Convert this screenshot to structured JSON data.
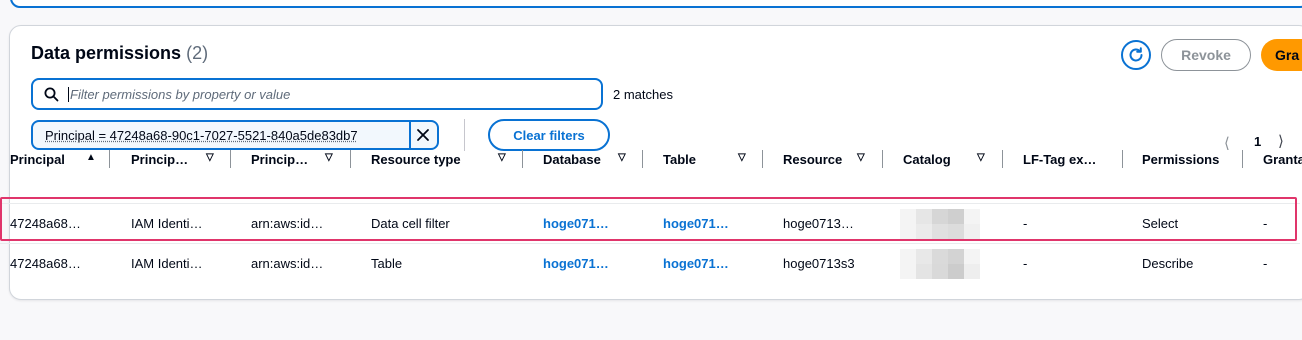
{
  "panel": {
    "title": "Data permissions",
    "count": "(2)",
    "revoke_label": "Revoke",
    "grant_label": "Gra"
  },
  "search": {
    "placeholder": "Filter permissions by property or value",
    "matches_text": "2 matches"
  },
  "filter_token": {
    "label": "Principal = 47248a68-90c1-7027-5521-840a5de83db7"
  },
  "clear_filters_label": "Clear filters",
  "pagination": {
    "current_page": "1"
  },
  "table": {
    "columns": [
      {
        "label": "Principal",
        "sort": "▲"
      },
      {
        "label": "Princip…",
        "sort": "▽"
      },
      {
        "label": "Princip…",
        "sort": "▽"
      },
      {
        "label": "Resource type",
        "sort": "▽"
      },
      {
        "label": "Database",
        "sort": "▽"
      },
      {
        "label": "Table",
        "sort": "▽"
      },
      {
        "label": "Resource",
        "sort": "▽"
      },
      {
        "label": "Catalog",
        "sort": "▽"
      },
      {
        "label": "LF-Tag ex…",
        "sort": ""
      },
      {
        "label": "Permissions",
        "sort": ""
      },
      {
        "label": "Granta",
        "sort": ""
      }
    ],
    "rows": [
      {
        "principal": "47248a68…",
        "principal_type": "IAM Identi…",
        "principal_arn": "arn:aws:id…",
        "resource_type": "Data cell filter",
        "database": "hoge071…",
        "table": "hoge071…",
        "resource": "hoge0713…",
        "lf_tag": "-",
        "permissions": "Select",
        "grantable": "-"
      },
      {
        "principal": "47248a68…",
        "principal_type": "IAM Identi…",
        "principal_arn": "arn:aws:id…",
        "resource_type": "Table",
        "database": "hoge071…",
        "table": "hoge071…",
        "resource": "hoge0713s3",
        "lf_tag": "-",
        "permissions": "Describe",
        "grantable": "-"
      }
    ]
  },
  "colors": {
    "accent": "#0972d3",
    "grant_button": "#ff9900",
    "highlight": "#e0356b"
  }
}
